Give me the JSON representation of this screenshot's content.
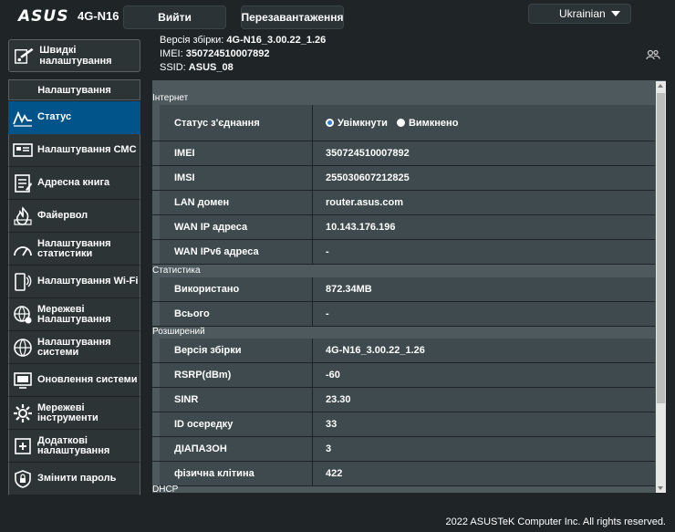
{
  "header": {
    "logo": "ASUS",
    "model": "4G-N16",
    "logout_label": "Вийти",
    "reboot_label": "Перезавантаження",
    "language": "Ukrainian"
  },
  "info": {
    "firmware_label": "Версія збірки:",
    "firmware_value": "4G-N16_3.00.22_1.26",
    "imei_label": "IMEI:",
    "imei_value": "350724510007892",
    "ssid_label": "SSID:",
    "ssid_value": "ASUS_08"
  },
  "sidebar": {
    "quick_setup": "Швидкі налаштування",
    "section_header": "Налаштування",
    "items": [
      {
        "label": "Статус",
        "icon": "status-icon",
        "active": true
      },
      {
        "label": "Налаштування СМС",
        "icon": "sms-icon"
      },
      {
        "label": "Адресна книга",
        "icon": "address-book-icon"
      },
      {
        "label": "Файервол",
        "icon": "firewall-icon"
      },
      {
        "label": "Налаштування статистики",
        "icon": "statistics-icon"
      },
      {
        "label": "Налаштування Wi-Fi",
        "icon": "wifi-icon"
      },
      {
        "label": "Мережеві Налаштування",
        "icon": "network-icon"
      },
      {
        "label": "Налаштування системи",
        "icon": "system-icon"
      },
      {
        "label": "Оновлення системи",
        "icon": "update-icon"
      },
      {
        "label": "Мережеві інструменти",
        "icon": "tools-icon"
      },
      {
        "label": "Додаткові налаштування",
        "icon": "advanced-icon"
      },
      {
        "label": "Змінити пароль",
        "icon": "lock-icon"
      }
    ]
  },
  "main": {
    "internet": {
      "title": "Інтернет",
      "connection_label": "Статус з'єднання",
      "on_label": "Увімкнути",
      "off_label": "Вимкнено",
      "rows": [
        {
          "k": "IMEI",
          "v": "350724510007892"
        },
        {
          "k": "IMSI",
          "v": "255030607212825"
        },
        {
          "k": "LAN домен",
          "v": "router.asus.com"
        },
        {
          "k": "WAN IP адреса",
          "v": "10.143.176.196"
        },
        {
          "k": "WAN IPv6 адреса",
          "v": "-"
        }
      ]
    },
    "stats": {
      "title": "Статистика",
      "rows": [
        {
          "k": "Використано",
          "v": "872.34MB"
        },
        {
          "k": "Всього",
          "v": "-"
        }
      ]
    },
    "extended": {
      "title": "Розширений",
      "rows": [
        {
          "k": "Версія збірки",
          "v": "4G-N16_3.00.22_1.26"
        },
        {
          "k": "RSRP(dBm)",
          "v": "-60"
        },
        {
          "k": "SINR",
          "v": "23.30"
        },
        {
          "k": "ID осередку",
          "v": "33"
        },
        {
          "k": "ДІАПАЗОН",
          "v": "3"
        },
        {
          "k": "фізична клітина",
          "v": "422"
        }
      ]
    },
    "dhcp_title": "DHCP"
  },
  "footer": {
    "copyright": "2022 ASUSTeK Computer Inc. All rights reserved."
  }
}
